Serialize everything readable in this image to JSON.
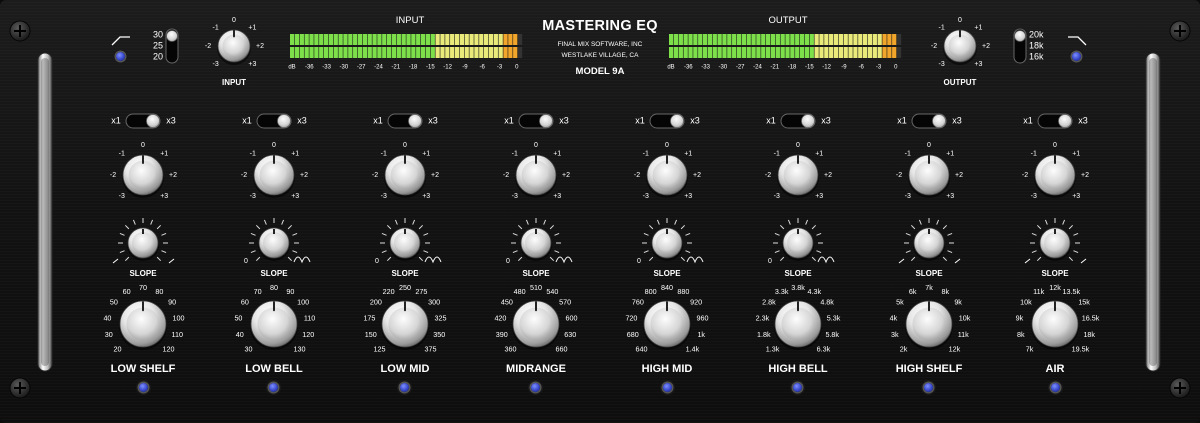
{
  "header": {
    "title": "MASTERING EQ",
    "maker": "FINAL MIX SOFTWARE, INC",
    "location": "WESTLAKE VILLAGE, CA",
    "model": "MODEL 9A"
  },
  "meters": {
    "input_label": "INPUT",
    "output_label": "OUTPUT",
    "scale": [
      "dB",
      "-36",
      "-33",
      "-30",
      "-27",
      "-24",
      "-21",
      "-18",
      "-15",
      "-12",
      "-9",
      "-6",
      "-3",
      "0"
    ],
    "input_level": 0.97,
    "output_level": 0.97,
    "colors": {
      "green": "#7de04a",
      "yellow": "#e9ea7a",
      "orange": "#f1a52a",
      "red": "#e8332a"
    }
  },
  "input_section": {
    "knob_label": "INPUT",
    "gain_scale": [
      "-3",
      "-2",
      "-1",
      "0",
      "+1",
      "+2",
      "+3"
    ],
    "hp_switch": [
      "30",
      "25",
      "20"
    ],
    "hp_icon": "high-pass-filter-icon"
  },
  "output_section": {
    "knob_label": "OUTPUT",
    "gain_scale": [
      "-3",
      "-2",
      "-1",
      "0",
      "+1",
      "+2",
      "+3"
    ],
    "lp_switch": [
      "20k",
      "18k",
      "16k"
    ],
    "lp_icon": "low-pass-filter-icon"
  },
  "range_switch": {
    "low": "x1",
    "high": "x3"
  },
  "gain_scale": [
    "-3",
    "-2",
    "-1",
    "0",
    "+1",
    "+2",
    "+3"
  ],
  "slope_label": "SLOPE",
  "bands": [
    {
      "name": "LOW SHELF",
      "slope_icon": "shelf-curve-icon",
      "freqs": [
        "20",
        "30",
        "40",
        "50",
        "60",
        "70",
        "80",
        "90",
        "100",
        "110",
        "120"
      ]
    },
    {
      "name": "LOW BELL",
      "slope_icon": "bell-curve-icon",
      "freqs": [
        "30",
        "40",
        "50",
        "60",
        "70",
        "80",
        "90",
        "100",
        "110",
        "120",
        "130"
      ]
    },
    {
      "name": "LOW MID",
      "slope_icon": "bell-curve-icon",
      "freqs": [
        "125",
        "150",
        "175",
        "200",
        "220",
        "250",
        "275",
        "300",
        "325",
        "350",
        "375"
      ]
    },
    {
      "name": "MIDRANGE",
      "slope_icon": "bell-curve-icon",
      "freqs": [
        "360",
        "390",
        "420",
        "450",
        "480",
        "510",
        "540",
        "570",
        "600",
        "630",
        "660"
      ]
    },
    {
      "name": "HIGH MID",
      "slope_icon": "bell-curve-icon",
      "freqs": [
        "640",
        "680",
        "720",
        "760",
        "800",
        "840",
        "880",
        "920",
        "960",
        "1k",
        "1.4k"
      ]
    },
    {
      "name": "HIGH BELL",
      "slope_icon": "bell-curve-icon",
      "freqs": [
        "1.3k",
        "1.8k",
        "2.3k",
        "2.8k",
        "3.3k",
        "3.8k",
        "4.3k",
        "4.8k",
        "5.3k",
        "5.8k",
        "6.3k"
      ]
    },
    {
      "name": "HIGH SHELF",
      "slope_icon": "shelf-curve-icon",
      "freqs": [
        "2k",
        "3k",
        "4k",
        "5k",
        "6k",
        "7k",
        "8k",
        "9k",
        "10k",
        "11k",
        "12k"
      ]
    },
    {
      "name": "AIR",
      "slope_icon": "shelf-curve-icon",
      "freqs": [
        "7k",
        "8k",
        "9k",
        "10k",
        "11k",
        "12k",
        "13.5k",
        "15k",
        "16.5k",
        "18k",
        "19.5k"
      ]
    }
  ],
  "colors": {
    "panel": "#141414",
    "knob": "#e8e8e8",
    "led": "#3646c8",
    "text": "#ffffff"
  }
}
